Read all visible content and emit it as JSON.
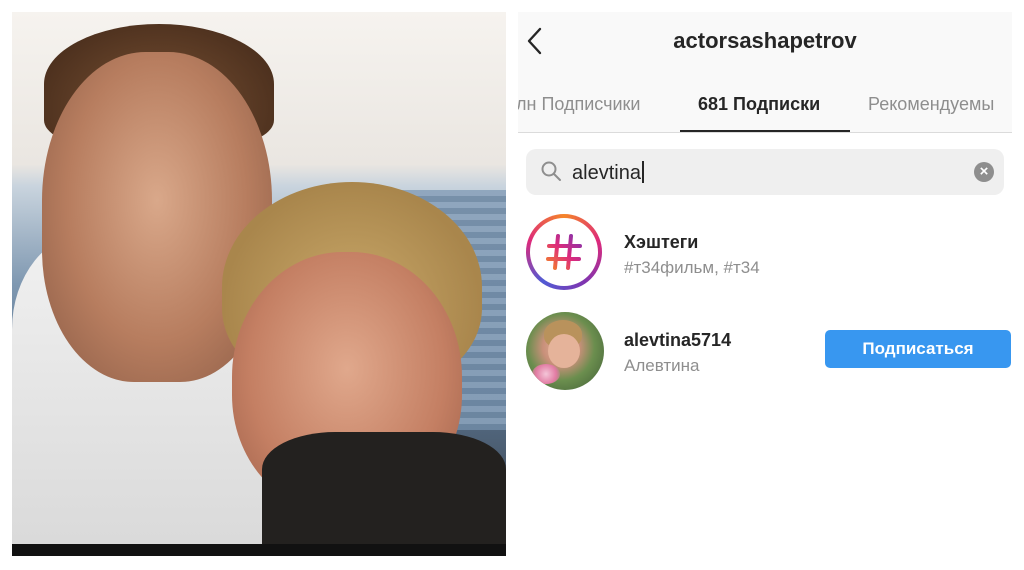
{
  "header": {
    "username": "actorsashapetrov",
    "back_icon": "chevron-left-icon"
  },
  "tabs": [
    {
      "label": "лн Подписчики",
      "active": false
    },
    {
      "label": "681 Подписки",
      "active": true
    },
    {
      "label": "Рекомендуемы",
      "active": false
    }
  ],
  "search": {
    "value": "alevtina",
    "search_icon": "search-icon",
    "clear_icon": "clear-icon"
  },
  "results": [
    {
      "title": "Хэштеги",
      "subtitle": "#т34фильм, #т34",
      "icon": "hashtag-icon"
    },
    {
      "title": "alevtina5714",
      "subtitle": "Алевтина",
      "button": "Подписаться"
    }
  ],
  "colors": {
    "accent": "#3897f0",
    "text": "#262626",
    "muted": "#8e8e8e"
  }
}
